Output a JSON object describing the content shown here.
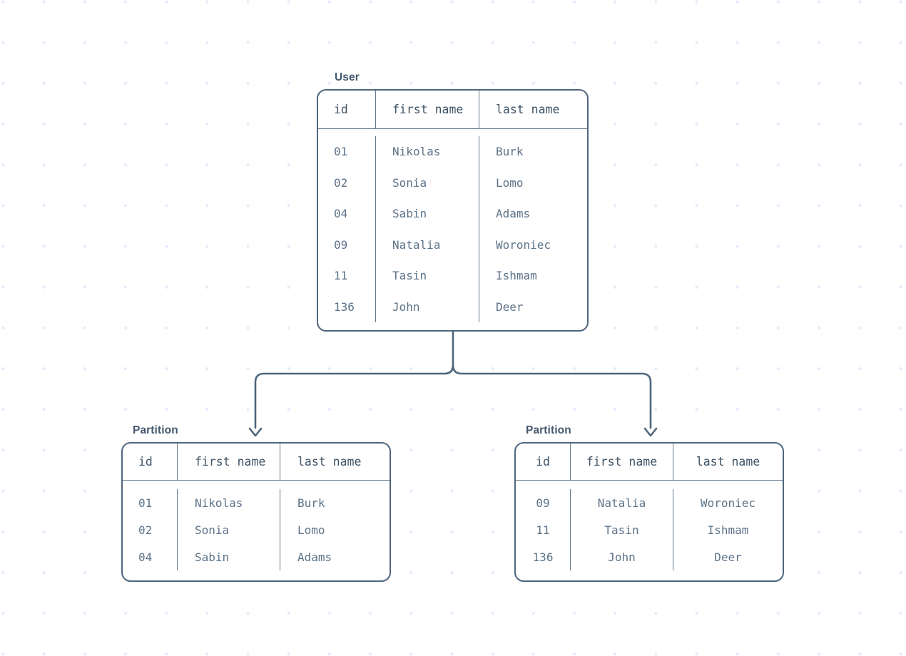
{
  "diagram": {
    "title_source": "database-horizontal-partitioning",
    "columns": [
      "id",
      "first name",
      "last name"
    ],
    "colors": {
      "stroke": "#4f667d",
      "header_text": "#3f5468",
      "body_text": "#5d7389",
      "grid_dot": "#e3ecfa",
      "background": "#ffffff"
    }
  },
  "source_table": {
    "label": "User",
    "headers": [
      "id",
      "first name",
      "last name"
    ],
    "rows": [
      [
        "01",
        "Nikolas",
        "Burk"
      ],
      [
        "02",
        "Sonia",
        "Lomo"
      ],
      [
        "04",
        "Sabin",
        "Adams"
      ],
      [
        "09",
        "Natalia",
        "Woroniec"
      ],
      [
        "11",
        "Tasin",
        "Ishmam"
      ],
      [
        "136",
        "John",
        "Deer"
      ]
    ]
  },
  "partitions": [
    {
      "label": "Partition",
      "headers": [
        "id",
        "first name",
        "last name"
      ],
      "rows": [
        [
          "01",
          "Nikolas",
          "Burk"
        ],
        [
          "02",
          "Sonia",
          "Lomo"
        ],
        [
          "04",
          "Sabin",
          "Adams"
        ]
      ]
    },
    {
      "label": "Partition",
      "headers": [
        "id",
        "first name",
        "last name"
      ],
      "rows": [
        [
          "09",
          "Natalia",
          "Woroniec"
        ],
        [
          "11",
          "Tasin",
          "Ishmam"
        ],
        [
          "136",
          "John",
          "Deer"
        ]
      ]
    }
  ]
}
